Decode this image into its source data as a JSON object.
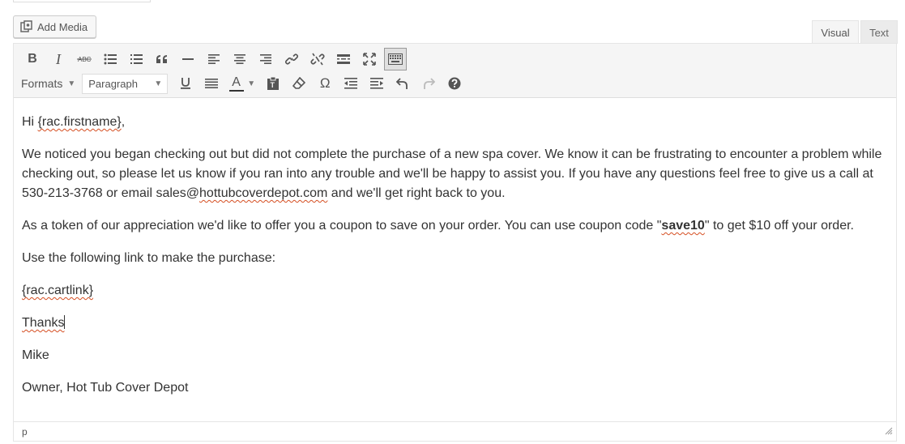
{
  "media": {
    "add_label": "Add Media"
  },
  "tabs": {
    "visual": "Visual",
    "text": "Text"
  },
  "toolbar": {
    "formats_label": "Formats",
    "block_format": "Paragraph",
    "text_color_letter": "A",
    "special_char": "Ω",
    "bold": "B",
    "italic": "I"
  },
  "content": {
    "greeting_pre": "Hi ",
    "greeting_var": "{rac.firstname}",
    "greeting_post": ",",
    "p1_a": "We noticed you began checking out but did not complete the purchase of a new spa cover. We know it can be frustrating to encounter a problem while checking out, so please let us know if you ran into any trouble and we'll be happy to assist you. If you have any questions feel free to give us a call at 530-213-3768 or email sales@",
    "p1_link": "hottubcoverdepot.com",
    "p1_b": " and we'll get right back to you.",
    "p2_a": "As a token of our appreciation we'd like to offer you a coupon to save on your order. You can use coupon code \"",
    "p2_code": "save10",
    "p2_b": "\" to get $10 off your order.",
    "p3": "Use the following link to make the purchase:",
    "p4": "{rac.cartlink}",
    "p5": "Thanks",
    "p6": "Mike",
    "p7": "Owner, Hot Tub Cover Depot"
  },
  "status": {
    "path": "p"
  }
}
